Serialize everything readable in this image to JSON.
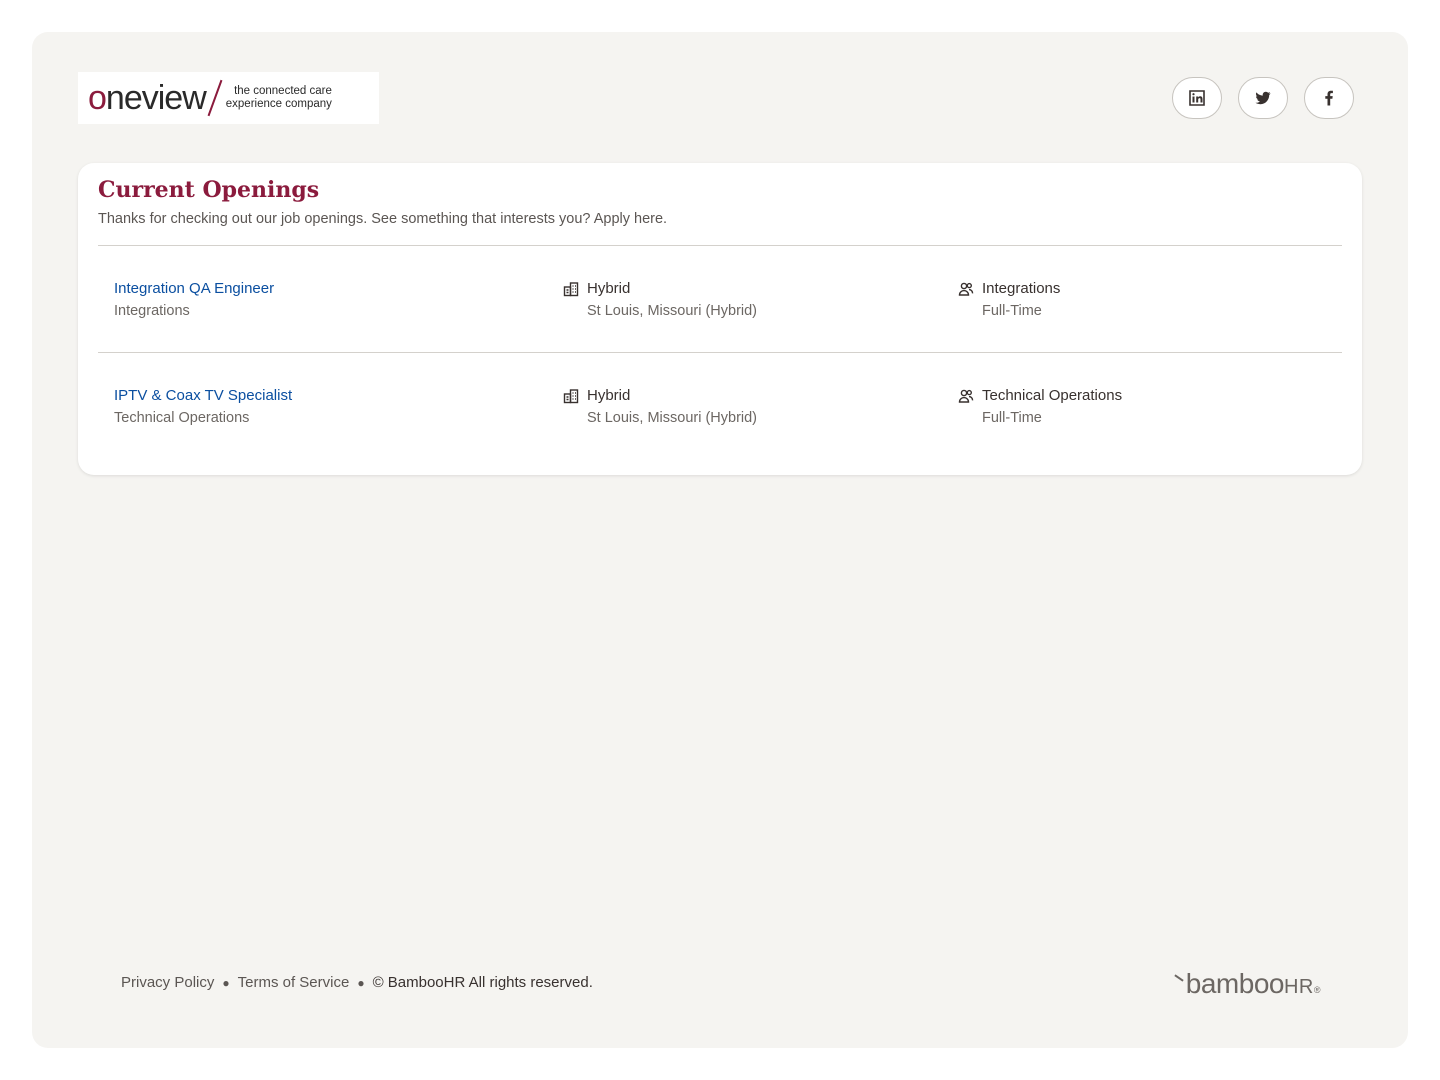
{
  "brand": {
    "logo_word": "oneview",
    "logo_tagline_1": "the connected care",
    "logo_tagline_2": "experience company"
  },
  "social": {
    "linkedin_icon": "linkedin-icon",
    "twitter_icon": "twitter-icon",
    "facebook_icon": "facebook-icon"
  },
  "card": {
    "title": "Current Openings",
    "subtitle": "Thanks for checking out our job openings. See something that interests you? Apply here."
  },
  "jobs": [
    {
      "title": "Integration QA Engineer",
      "department": "Integrations",
      "location_type": "Hybrid",
      "location": "St Louis, Missouri (Hybrid)",
      "team": "Integrations",
      "employment": "Full-Time"
    },
    {
      "title": "IPTV & Coax TV Specialist",
      "department": "Technical Operations",
      "location_type": "Hybrid",
      "location": "St Louis, Missouri (Hybrid)",
      "team": "Technical Operations",
      "employment": "Full-Time"
    }
  ],
  "footer": {
    "privacy": "Privacy Policy",
    "terms": "Terms of Service",
    "copyright": "© BambooHR All rights reserved.",
    "bamboo_word": "bamboo",
    "bamboo_hr": "HR",
    "bamboo_mark": "®"
  },
  "colors": {
    "brand": "#8b1b3d",
    "link": "#0b4fa0",
    "background": "#f5f4f1"
  }
}
